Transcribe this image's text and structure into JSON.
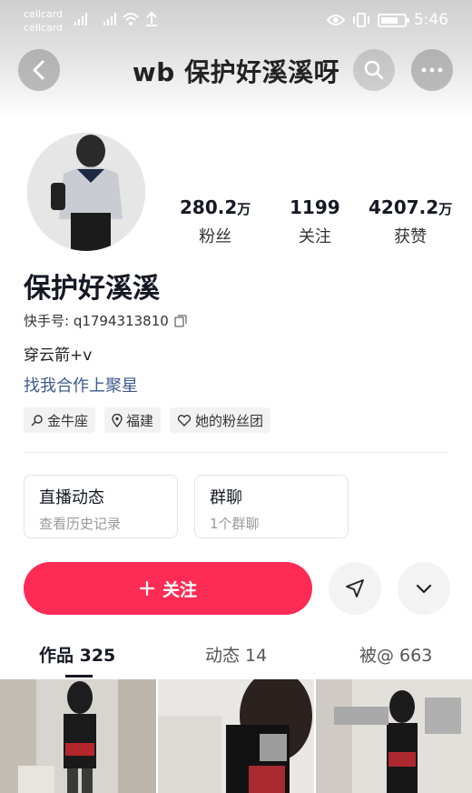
{
  "status_bar": {
    "carrier_top": "cellcard",
    "carrier_bottom": "cellcard",
    "time": "5:46"
  },
  "header": {
    "title": "wb 保护好溪溪呀"
  },
  "profile": {
    "stats": [
      {
        "value": "280.2",
        "unit": "万",
        "label": "粉丝"
      },
      {
        "value": "1199",
        "unit": "",
        "label": "关注"
      },
      {
        "value": "4207.2",
        "unit": "万",
        "label": "获赞"
      }
    ],
    "name": "保护好溪溪",
    "uid_label": "快手号: q1794313810",
    "bio": "穿云箭+v",
    "link": "找我合作上聚星",
    "tags": [
      {
        "icon": "zodiac-icon",
        "label": "金牛座"
      },
      {
        "icon": "location-icon",
        "label": "福建"
      },
      {
        "icon": "heart-icon",
        "label": "她的粉丝团"
      }
    ]
  },
  "cards": [
    {
      "title": "直播动态",
      "subtitle": "查看历史记录"
    },
    {
      "title": "群聊",
      "subtitle": "1个群聊"
    }
  ],
  "actions": {
    "follow_label": "关注"
  },
  "tabs": [
    {
      "label": "作品 325",
      "active": true
    },
    {
      "label": "动态 14",
      "active": false
    },
    {
      "label": "被@ 663",
      "active": false
    }
  ],
  "colors": {
    "accent": "#fe2c55",
    "link": "#3d5b8c"
  }
}
